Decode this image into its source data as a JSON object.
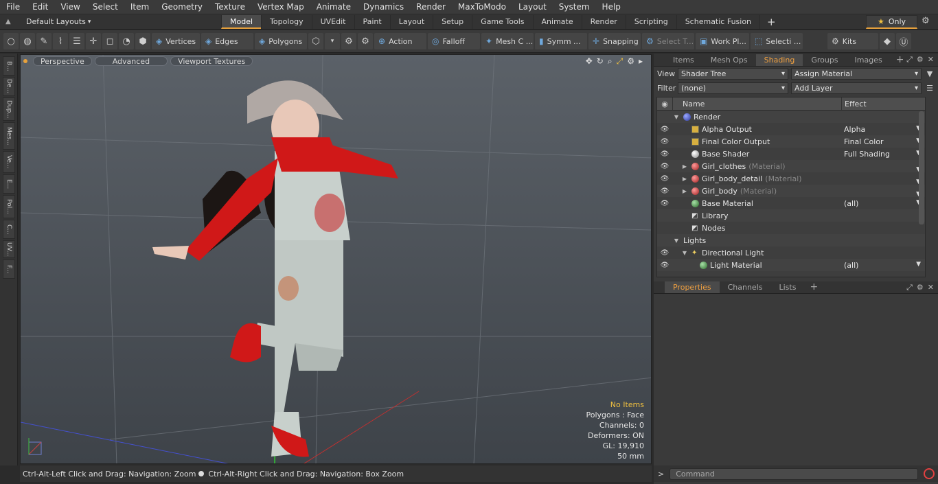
{
  "menu": [
    "File",
    "Edit",
    "View",
    "Select",
    "Item",
    "Geometry",
    "Texture",
    "Vertex Map",
    "Animate",
    "Dynamics",
    "Render",
    "MaxToModo",
    "Layout",
    "System",
    "Help"
  ],
  "layout": {
    "label": "Default Layouts"
  },
  "layout_tabs": [
    "Model",
    "Topology",
    "UVEdit",
    "Paint",
    "Layout",
    "Setup",
    "Game Tools",
    "Animate",
    "Render",
    "Scripting",
    "Schematic Fusion"
  ],
  "only_label": "Only",
  "toolbar": {
    "vertices": "Vertices",
    "edges": "Edges",
    "polygons": "Polygons",
    "action": "Action",
    "falloff": "Falloff",
    "mesh": "Mesh C ...",
    "symm": "Symm ...",
    "snapping": "Snapping",
    "select_t": "Select T...",
    "work_pl": "Work Pl...",
    "selecti": "Selecti ...",
    "kits": "Kits"
  },
  "left_tabs": [
    "B...",
    "De...",
    "Dup...",
    "Mes...",
    "Ve...",
    "E...",
    "Pol...",
    "C...",
    "UV...",
    "F..."
  ],
  "viewport": {
    "perspective": "Perspective",
    "advanced": "Advanced",
    "textures": "Viewport Textures",
    "stats": {
      "items": "No Items",
      "polygons": "Polygons : Face",
      "channels": "Channels: 0",
      "deformers": "Deformers: ON",
      "gl": "GL: 19,910",
      "lens": "50 mm"
    }
  },
  "status": {
    "left": "Ctrl-Alt-Left Click and Drag: Navigation: Zoom",
    "right": "Ctrl-Alt-Right Click and Drag: Navigation: Box Zoom"
  },
  "panel": {
    "tabs": [
      "Items",
      "Mesh Ops",
      "Shading",
      "Groups",
      "Images"
    ],
    "view_label": "View",
    "view_value": "Shader Tree",
    "assign": "Assign Material",
    "filter_label": "Filter",
    "filter_value": "(none)",
    "add_layer": "Add Layer",
    "col_name": "Name",
    "col_effect": "Effect",
    "rows": [
      {
        "name": "Render",
        "effect": ""
      },
      {
        "name": "Alpha Output",
        "effect": "Alpha"
      },
      {
        "name": "Final Color Output",
        "effect": "Final Color"
      },
      {
        "name": "Base Shader",
        "effect": "Full Shading"
      },
      {
        "name": "Girl_clothes",
        "tag": "(Material)",
        "effect": ""
      },
      {
        "name": "Girl_body_detail",
        "tag": "(Material)",
        "effect": ""
      },
      {
        "name": "Girl_body",
        "tag": "(Material)",
        "effect": ""
      },
      {
        "name": "Base Material",
        "effect": "(all)"
      },
      {
        "name": "Library",
        "effect": ""
      },
      {
        "name": "Nodes",
        "effect": ""
      },
      {
        "name": "Lights",
        "effect": ""
      },
      {
        "name": "Directional Light",
        "effect": ""
      },
      {
        "name": "Light Material",
        "effect": "(all)"
      }
    ],
    "props_tabs": [
      "Properties",
      "Channels",
      "Lists"
    ],
    "command_placeholder": "Command"
  }
}
